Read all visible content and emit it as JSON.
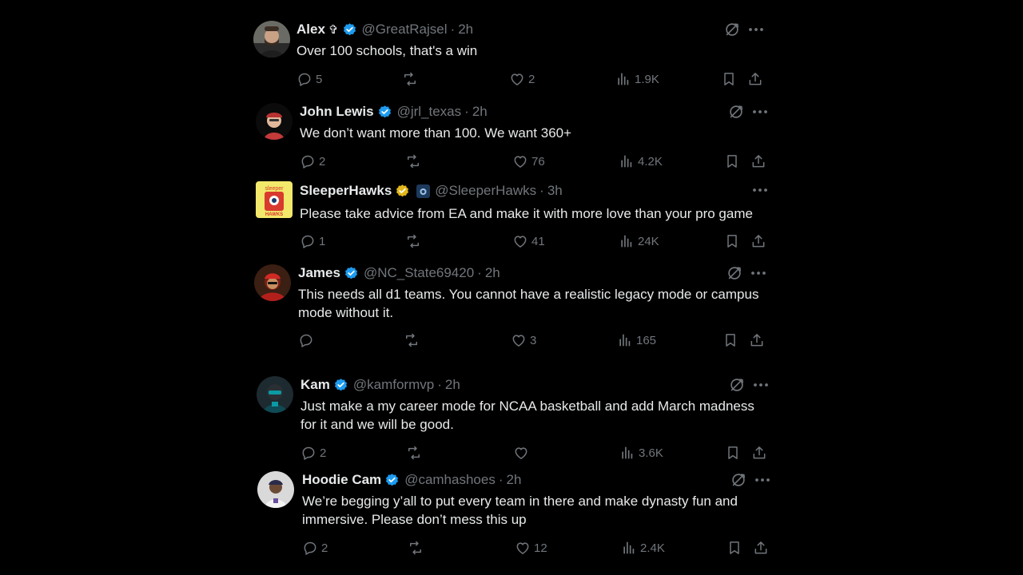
{
  "tweets": [
    {
      "name": "Alex",
      "extra": "✞",
      "handle": "@GreatRajsel",
      "time": "2h",
      "text": "Over 100 schools, that's a win",
      "replies": "5",
      "retweets": "",
      "likes": "2",
      "views": "1.9K",
      "badge_color": "#1d9bf0",
      "show_grok": true
    },
    {
      "name": "John Lewis",
      "extra": "",
      "handle": "@jrl_texas",
      "time": "2h",
      "text": "We don’t want more than 100. We want 360+",
      "replies": "2",
      "retweets": "",
      "likes": "76",
      "views": "4.2K",
      "badge_color": "#1d9bf0",
      "show_grok": true
    },
    {
      "name": "SleeperHawks",
      "extra": "",
      "handle": "@SleeperHawks",
      "time": "3h",
      "text": "Please take advice from EA and make it with more love than your pro game",
      "replies": "1",
      "retweets": "",
      "likes": "41",
      "views": "24K",
      "badge_color": "#e2b719",
      "show_grok": false,
      "avatar_text_top": "sleeper",
      "avatar_text_bottom": "HAWKS"
    },
    {
      "name": "James",
      "extra": "",
      "handle": "@NC_State69420",
      "time": "2h",
      "text": "This needs all d1 teams. You cannot have a realistic legacy mode or campus mode without it.",
      "replies": "",
      "retweets": "",
      "likes": "3",
      "views": "165",
      "badge_color": "#1d9bf0",
      "show_grok": true
    },
    {
      "name": "Kam",
      "extra": "",
      "handle": "@kamformvp",
      "time": "2h",
      "text": "Just make a my career mode for NCAA basketball and add March madness for it and we will be good.",
      "replies": "2",
      "retweets": "",
      "likes": "",
      "views": "3.6K",
      "badge_color": "#1d9bf0",
      "show_grok": true
    },
    {
      "name": "Hoodie Cam",
      "extra": "",
      "handle": "@camhashoes",
      "time": "2h",
      "text": "We’re begging y’all to put every team in there and make dynasty fun and immersive. Please don’t mess this up",
      "replies": "2",
      "retweets": "",
      "likes": "12",
      "views": "2.4K",
      "badge_color": "#1d9bf0",
      "show_grok": true
    }
  ],
  "separator": "·",
  "icons": [
    "reply-icon",
    "retweet-icon",
    "like-icon",
    "views-icon",
    "bookmark-icon",
    "share-icon",
    "grok-icon",
    "more-icon",
    "verified-badge-icon"
  ]
}
